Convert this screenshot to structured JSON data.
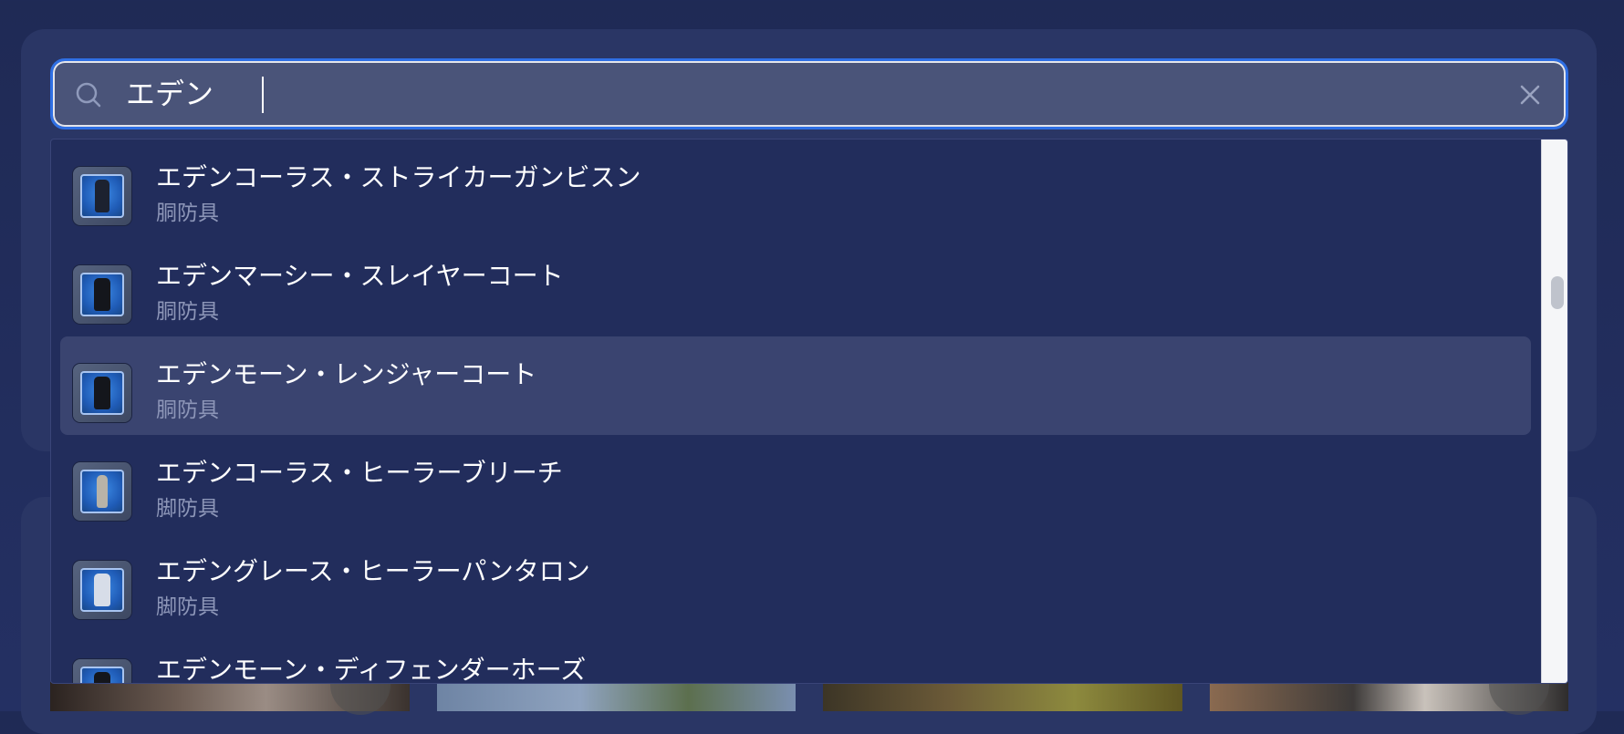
{
  "search": {
    "value": "エデン",
    "placeholder": ""
  },
  "icons": {
    "search": "search-icon",
    "clear": "close-icon"
  },
  "results": [
    {
      "name": "エデンコーラス・ストライカーガンビスン",
      "category": "胴防具"
    },
    {
      "name": "エデンマーシー・スレイヤーコート",
      "category": "胴防具"
    },
    {
      "name": "エデンモーン・レンジャーコート",
      "category": "胴防具",
      "selected": true
    },
    {
      "name": "エデンコーラス・ヒーラーブリーチ",
      "category": "脚防具"
    },
    {
      "name": "エデングレース・ヒーラーパンタロン",
      "category": "脚防具"
    },
    {
      "name": "エデンモーン・ディフェンダーホーズ",
      "category": ""
    }
  ],
  "colors": {
    "accent": "#2f6fe4",
    "selected_row": "#3a4470",
    "dropdown_bg": "#222d5c",
    "subtext": "#8d96b8"
  }
}
